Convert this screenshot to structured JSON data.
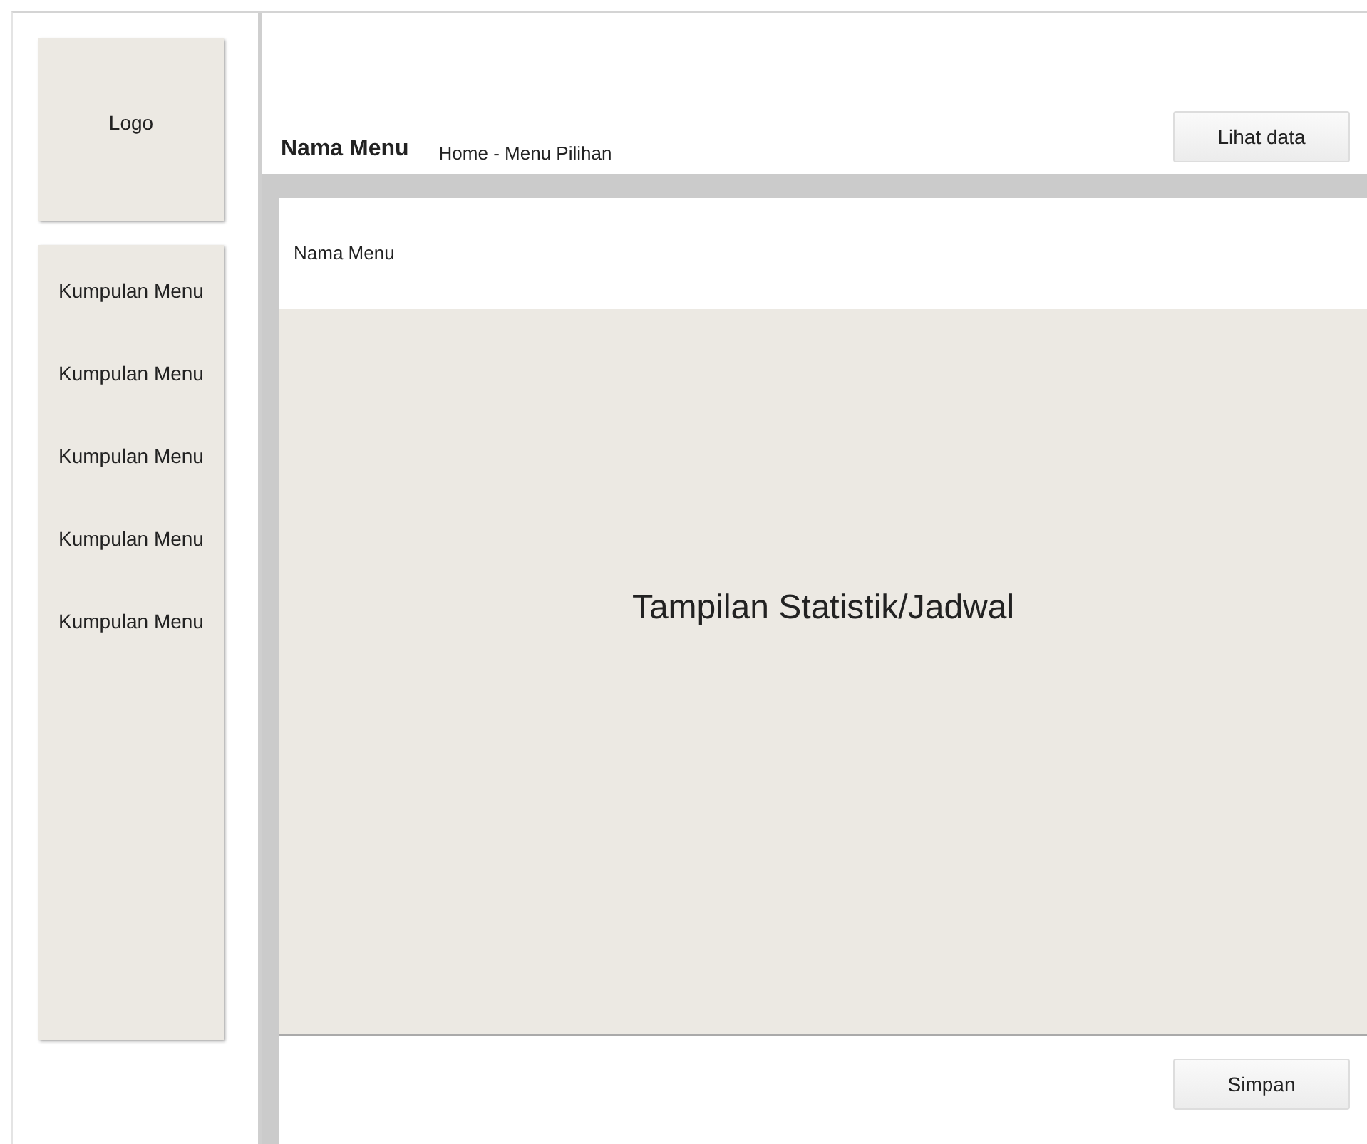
{
  "sidebar": {
    "logo": "Logo",
    "items": [
      {
        "label": "Kumpulan Menu"
      },
      {
        "label": "Kumpulan Menu"
      },
      {
        "label": "Kumpulan Menu"
      },
      {
        "label": "Kumpulan Menu"
      },
      {
        "label": "Kumpulan Menu"
      }
    ]
  },
  "header": {
    "title": "Nama Menu",
    "breadcrumb": "Home - Menu Pilihan",
    "button": "Lihat data"
  },
  "content": {
    "title": "Nama Menu",
    "placeholder_text": "Tampilan Statistik/Jadwal"
  },
  "footer": {
    "button": "Simpan"
  }
}
